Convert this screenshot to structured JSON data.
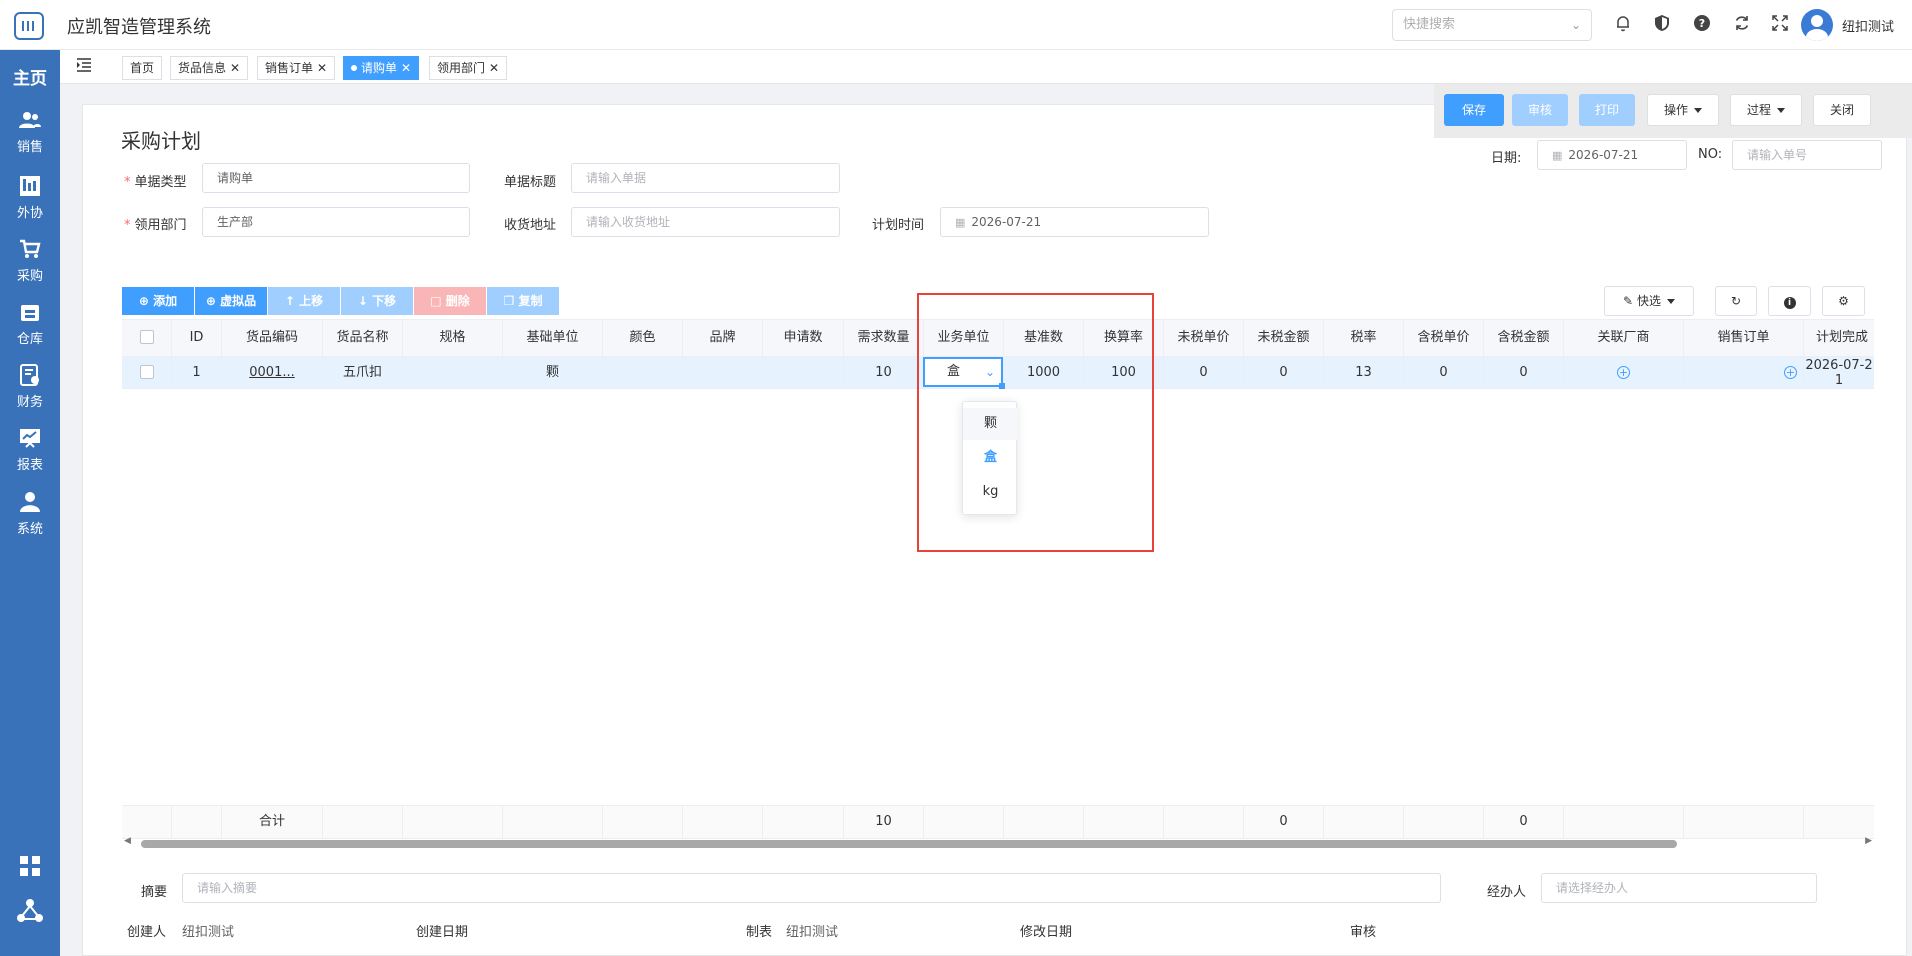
{
  "app": {
    "title": "应凯智造管理系统",
    "username": "纽扣测试",
    "search_placeholder": "快捷搜索"
  },
  "sidebar": {
    "home": "主页",
    "items": [
      {
        "label": "销售",
        "icon": "users-icon"
      },
      {
        "label": "外协",
        "icon": "factory-icon"
      },
      {
        "label": "采购",
        "icon": "cart-icon"
      },
      {
        "label": "仓库",
        "icon": "warehouse-icon"
      },
      {
        "label": "财务",
        "icon": "finance-icon"
      },
      {
        "label": "报表",
        "icon": "report-icon"
      },
      {
        "label": "系统",
        "icon": "user-icon"
      }
    ]
  },
  "tabs": [
    {
      "label": "首页",
      "closable": false,
      "active": false
    },
    {
      "label": "货品信息",
      "closable": true,
      "active": false
    },
    {
      "label": "销售订单",
      "closable": true,
      "active": false
    },
    {
      "label": "请购单",
      "closable": true,
      "active": true
    },
    {
      "label": "领用部门",
      "closable": true,
      "active": false
    }
  ],
  "actions": {
    "save": "保存",
    "audit": "审核",
    "print": "打印",
    "operate": "操作",
    "process": "过程",
    "close": "关闭"
  },
  "header_meta": {
    "date_label": "日期:",
    "date_value": "2026-07-21",
    "no_label": "NO:",
    "no_placeholder": "请输入单号"
  },
  "form": {
    "title": "采购计划",
    "doc_type_label": "单据类型",
    "doc_type_value": "请购单",
    "doc_title_label": "单据标题",
    "doc_title_placeholder": "请输入单据",
    "dept_label": "领用部门",
    "dept_value": "生产部",
    "address_label": "收货地址",
    "address_placeholder": "请输入收货地址",
    "plan_time_label": "计划时间",
    "plan_time_value": "2026-07-21"
  },
  "toolbar": {
    "add": "添加",
    "virtual": "虚拟品",
    "up": "上移",
    "down": "下移",
    "delete": "删除",
    "copy": "复制",
    "quick_filter": "快选"
  },
  "table": {
    "columns": [
      "ID",
      "货品编码",
      "货品名称",
      "规格",
      "基础单位",
      "颜色",
      "品牌",
      "申请数",
      "需求数量",
      "业务单位",
      "基准数",
      "换算率",
      "未税单价",
      "未税金额",
      "税率",
      "含税单价",
      "含税金额",
      "关联厂商",
      "销售订单",
      "计划完成"
    ],
    "rows": [
      {
        "id": "1",
        "code": "0001...",
        "name": "五爪扣",
        "spec": "",
        "base_unit": "颗",
        "color": "",
        "brand": "",
        "apply_qty": "",
        "demand_qty": "10",
        "biz_unit": "盒",
        "base_num": "1000",
        "rate": "100",
        "untaxed_price": "0",
        "untaxed_amount": "0",
        "tax_rate": "13",
        "taxed_price": "0",
        "taxed_amount": "0",
        "plan_done": "2026-07-21"
      }
    ],
    "footer": {
      "label": "合计",
      "demand_total": "10",
      "untaxed_total": "0",
      "taxed_total": "0"
    },
    "unit_options": [
      "颗",
      "盒",
      "kg"
    ],
    "unit_selected": "盒"
  },
  "bottom": {
    "summary_label": "摘要",
    "summary_placeholder": "请输入摘要",
    "handler_label": "经办人",
    "handler_placeholder": "请选择经办人",
    "creator_label": "创建人",
    "creator_value": "纽扣测试",
    "created_date_label": "创建日期",
    "maker_label": "制表",
    "maker_value": "纽扣测试",
    "modified_date_label": "修改日期",
    "auditor_label": "审核"
  },
  "colors": {
    "primary": "#409eff",
    "sidebar": "#3a72b9",
    "highlight": "#e6433a"
  }
}
